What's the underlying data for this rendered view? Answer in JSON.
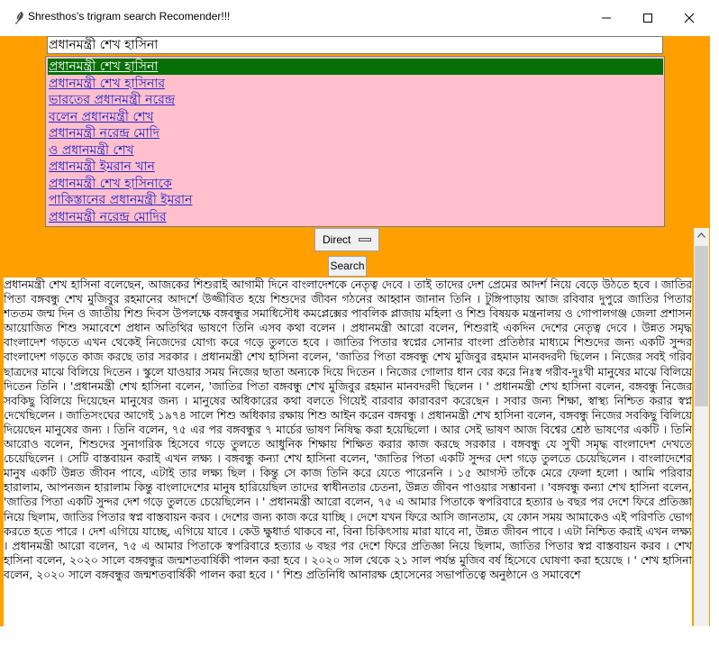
{
  "window": {
    "title": "Shresthos's trigram search Recomender!!!",
    "accent_color": "#ff9f00",
    "selected_color": "#067006",
    "list_bg_color": "#ffc0cb"
  },
  "search": {
    "value": "প্রধানমন্ত্রী শেখ হাসিনা"
  },
  "suggestions": [
    "প্রধানমন্ত্রী শেখ হাসিনা",
    "প্রধানমন্ত্রী শেখ হাসিনার",
    "ভারতের প্রধানমন্ত্রী নরেন্দ্র",
    "বলেন প্রধানমন্ত্রী শেখ",
    "প্রধানমন্ত্রী নরেন্দ্র মোদি",
    "ও প্রধানমন্ত্রী শেখ",
    "প্রধানমন্ত্রী ইমরান খান",
    "প্রধানমন্ত্রী শেখ হাসিনাকে",
    "পাকিস্তানের প্রধানমন্ত্রী ইমরান",
    "প্রধানমন্ত্রী নরেন্দ্র মোদির"
  ],
  "mode": {
    "value": "Direct"
  },
  "search_button": {
    "label": "Search"
  },
  "result": {
    "text": "প্রধানমন্ত্রী শেখ হাসিনা বলেছেন, আজকের শিশুরাই আগামী দিনে বাংলাদেশকে নেতৃত্ব দেবে । তাই তাদের দেশ প্রেমের আদর্শ নিয়ে বেড়ে উঠতে হবে । জাতির পিতা বঙ্গবন্ধু শেখ মুজিবুর রহমানের আদর্শে উজ্জীবিত হয়ে শিশুদের জীবন গঠনের আহ্বান জানান তিনি । টুঙ্গিপাড়ায় আজ রবিবার দুপুরে জাতির পিতার শততম জন্ম দিন ও জাতীয় শিশু দিবস উপলক্ষে বঙ্গবন্ধুর সমাধিসৌধ কমপ্লেক্সের পাবলিক প্লাজায় মহিলা ও শিশু বিষয়ক মন্ত্রনালয় ও গোপালগঞ্জ জেলা প্রশাসন আয়োজিত শিশু সমাবেশে প্রধান অতিথির ভাষণে তিনি এসব কথা বলেন । প্রধানমন্ত্রী আরো বলেন, শিশুরাই একদিন দেশের নেতৃত্ব দেবে । উন্নত সমৃদ্ধ বাংলাদেশ গড়তে এখন থেকেই নিজেদের যোগ্য করে গড়ে তুলতে হবে । জাতির পিতার স্বপ্নের সোনার বাংলা প্রতিষ্ঠার মাধ্যমে শিশুদের জন্য একটি সুন্দর বাংলাদেশ গড়তে কাজ করছে তার সরকার । প্রধানমন্ত্রী শেখ হাসিনা বলেন, 'জাতির পিতা বঙ্গবন্ধু শেখ মুজিবুর রহমান মানবদরদী ছিলেন । নিজের সবই গরিব ছাত্রদের মাঝে বিলিয়ে দিতেন । স্কুলে যাওয়ার সময় নিজের ছাতা অন্যকে দিয়ে দিতেন । নিজের গোলার ধান বের করে নিঃস্ব গরীব-দুঃখী মানুষের মাঝে বিলিয়ে দিতেন তিনি । 'প্রধানমন্ত্রী শেখ হাসিনা বলেন, 'জাতির পিতা বঙ্গবন্ধু শেখ মুজিবুর রহমান মানবদরদী ছিলেন । ' প্রধানমন্ত্রী শেখ হাসিনা বলেন, বঙ্গবন্ধু নিজের সবকিছু বিলিয়ে দিয়েছেন মানুষের জন্য । মানুষের অধিকারের কথা বলতে গিয়েই বারবার কারাবরণ করেছেন । সবার জন্য শিক্ষা, স্বাস্থ্য নিশ্চিত করার স্বপ্ন দেখেছিলেন । জাতিসংঘের আগেই ১৯৭৪ সালে শিশু অধিকার রক্ষায় শিশু আইন করেন বঙ্গবন্ধু । প্রধানমন্ত্রী শেখ হাসিনা বলেন, বঙ্গবন্ধু নিজের সবকিছু বিলিয়ে দিয়েছেন মানুষের জন্য । তিনি বলেন, ৭৫ এর পর বঙ্গবন্ধুর ৭ মার্চের ভাষণ নিষিদ্ধ করা হয়েছিলো । আর সেই ভাষণ আজ বিশ্বের শ্রেষ্ঠ ভাষণের একটি । তিনি আরোও বলেন, শিশুদের সুনাগরিক হিসেবে গড়ে তুলতে আধুনিক শিক্ষায় শিক্ষিত করার কাজ করছে সরকার । বঙ্গবন্ধু যে সুখী সমৃদ্ধ বাংলাদেশ দেখতে চেয়েছিলেন । সেটি বাস্তবায়ন করাই এখন লক্ষ্য । বঙ্গবন্ধু কন্যা শেখ হাসিনা বলেন, 'জাতির পিতা একটি সুন্দর দেশ গড়ে তুলতে চেয়েছিলেন । বাংলাদেশের মানুষ একটি উন্নত জীবন পাবে, এটাই তার লক্ষ্য ছিল । কিন্তু সে কাজ তিনি করে যেতে পারেননি । ১৫ আগস্ট তাঁকে মেরে ফেলা হলো । আমি পরিবার হারালাম, আপনজন হারালাম কিন্তু বাংলাদেশের মানুষ হারিয়েছিল তাদের স্বাধীনতার চেতনা, উন্নত জীবন পাওয়ার সম্ভাবনা । 'বঙ্গবন্ধু কন্যা শেখ হাসিনা বলেন, 'জাতির পিতা একটি সুন্দর দেশ গড়ে তুলতে চেয়েছিলেন । ' প্রধানমন্ত্রী আরো বলেন, ৭৫ এ আমার পিতাকে স্বপরিবারে হত্যার ৬ বছর পর দেশে ফিরে প্রতিজ্ঞা নিয়ে ছিলাম, জাতির পিতার স্বপ্ন বাস্তবায়ন করব । দেশের জন্য কাজ করে যাচ্ছি । দেশে যখন ফিরে আসি জানতাম, যে কোন সময় আমাকেও এই পরিণতি ভোগ করতে হতে পারে । দেশ এগিয়ে যাচ্ছে, এগিয়ে যাবে । কেউ ক্ষুধার্ত থাকবে না, বিনা চিকিৎসায় মারা যাবে না, উন্নত জীবন পাবে । এটা নিশ্চিত করাই এখন লক্ষ্য । প্রধানমন্ত্রী আরো বলেন, ৭৫ এ আমার পিতাকে স্বপরিবারে হত্যার ৬ বছর পর দেশে ফিরে প্রতিজ্ঞা নিয়ে ছিলাম, জাতির পিতার স্বপ্ন বাস্তবায়ন করব । শেখ হাসিনা বলেন, ২০২০ সালে বঙ্গবন্ধুর জন্মশতবার্ষিকী পালন করা হবে । ২০২০ সাল থেকে ২১ সাল পর্যন্ত মুজিব বর্ষ হিসেবে ঘোষণা করা হয়েছে । ' শেখ হাসিনা বলেন, ২০২০ সালে বঙ্গবন্ধুর জন্মশতবার্ষিকী পালন করা হবে । ' শিশু প্রতিনিধি আনারক্ষ হোসেনের সভাপতিত্বে অনুষ্ঠানে ও সমাবেশে"
  }
}
